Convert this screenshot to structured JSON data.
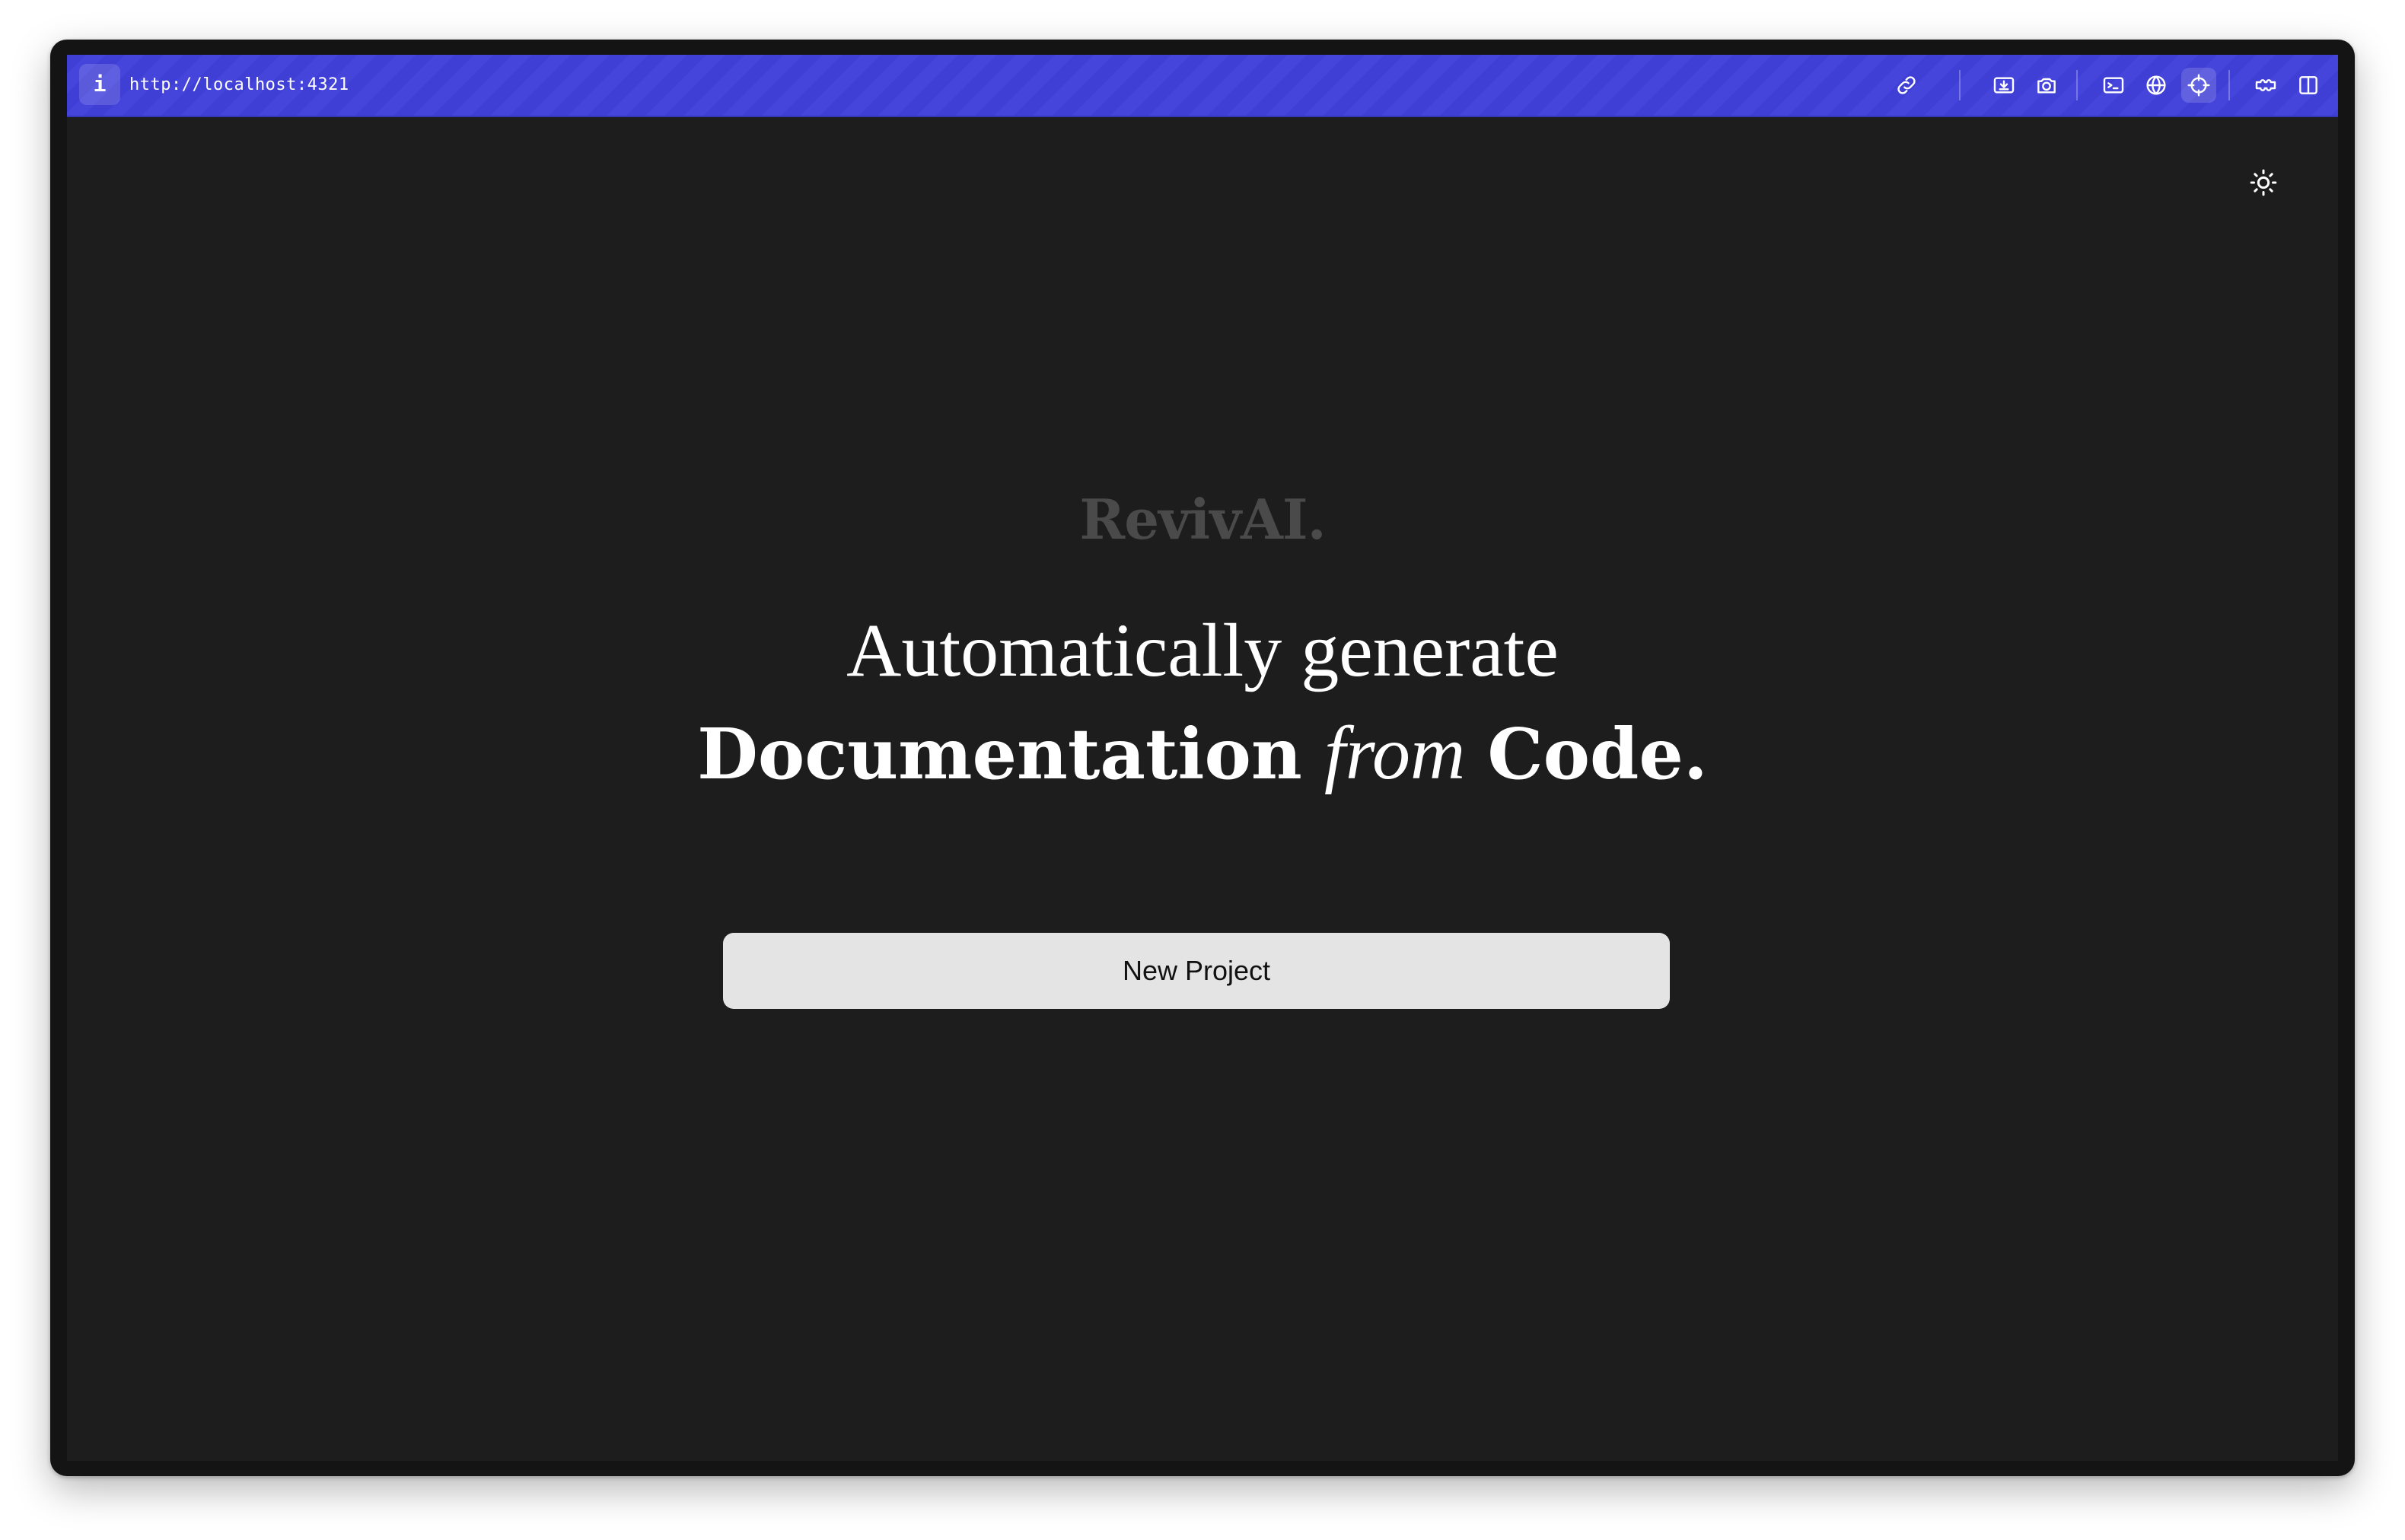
{
  "browser": {
    "info_label": "i",
    "url": "http://localhost:4321",
    "toolbar_icons": [
      "link-icon",
      "inspect-icon",
      "camera-icon",
      "terminal-icon",
      "globe-icon",
      "crosshair-icon",
      "extension-icon",
      "split-panel-icon"
    ],
    "accent": "#4040d8"
  },
  "page": {
    "theme_toggle_icon": "sun-icon",
    "brand": "RevivAI.",
    "headline_line1": "Automatically generate",
    "headline_word1": "Documentation",
    "headline_word2": "from",
    "headline_word3": "Code.",
    "cta_label": "New Project",
    "background": "#1d1d1d",
    "button_background": "#e4e4e4"
  }
}
